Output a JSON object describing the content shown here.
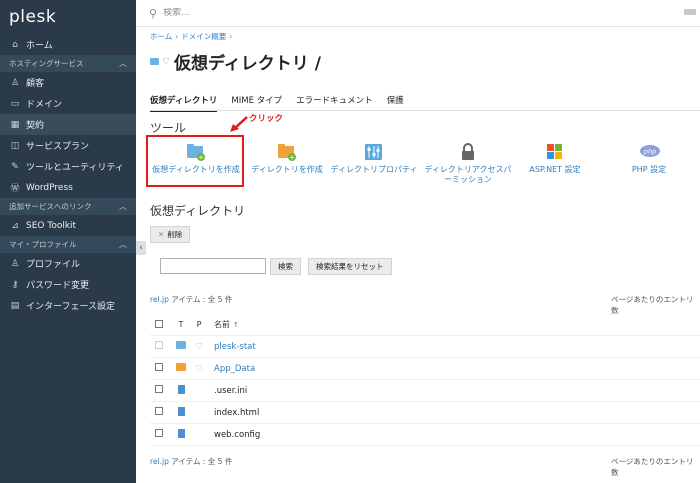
{
  "sidebar": {
    "logo": "plesk",
    "items": [
      {
        "label": "ホーム",
        "icon": "home-icon",
        "glyph": "⌂"
      },
      {
        "section": "ホスティングサービス"
      },
      {
        "label": "顧客",
        "icon": "user-icon",
        "glyph": "♙"
      },
      {
        "label": "ドメイン",
        "icon": "monitor-icon",
        "glyph": "▭"
      },
      {
        "label": "契約",
        "icon": "grid-icon",
        "glyph": "▦",
        "active": true
      },
      {
        "label": "サービスプラン",
        "icon": "book-icon",
        "glyph": "◫"
      },
      {
        "label": "ツールとユーティリティ",
        "icon": "tools-icon",
        "glyph": "✎"
      },
      {
        "label": "WordPress",
        "icon": "wordpress-icon",
        "glyph": "Ⓦ"
      },
      {
        "section": "追加サービスへのリンク"
      },
      {
        "label": "SEO Toolkit",
        "icon": "chart-icon",
        "glyph": "⊿"
      },
      {
        "section": "マイ・プロファイル"
      },
      {
        "label": "プロファイル",
        "icon": "profile-icon",
        "glyph": "♙"
      },
      {
        "label": "パスワード変更",
        "icon": "key-icon",
        "glyph": "⚷"
      },
      {
        "label": "インターフェース設定",
        "icon": "settings-icon",
        "glyph": "▤"
      }
    ]
  },
  "search": {
    "placeholder": "検索..."
  },
  "breadcrumb": {
    "items": [
      "ホーム",
      "ドメイン概要"
    ]
  },
  "page": {
    "title": "仮想ディレクトリ /"
  },
  "tabs": [
    "仮想ディレクトリ",
    "MIME タイプ",
    "エラードキュメント",
    "保護"
  ],
  "tools": {
    "heading": "ツール",
    "click_annotation": "クリック",
    "items": [
      {
        "label": "仮想ディレクトリを作成",
        "icon": "folder-add-icon",
        "color": "#6cb3e3"
      },
      {
        "label": "ディレクトリを作成",
        "icon": "folder-add-orange-icon",
        "color": "#f0a23a"
      },
      {
        "label": "ディレクトリプロパティ",
        "icon": "sliders-icon",
        "color": "#5aa7db"
      },
      {
        "label": "ディレクトリアクセスパーミッション",
        "icon": "lock-icon",
        "color": "#666666"
      },
      {
        "label": "ASP.NET 設定",
        "icon": "windows-icon",
        "color": "#e8532c"
      },
      {
        "label": "PHP 設定",
        "icon": "php-icon",
        "color": "#8f9ee0"
      }
    ]
  },
  "vdirs": {
    "heading": "仮想ディレクトリ",
    "delete_label": "削除",
    "search_label": "検索",
    "reset_label": "検索結果をリセット",
    "domain": "rel.jp",
    "count_text": " アイテム : 全 5 件",
    "per_page_text": "ページあたりのエントリ数",
    "columns": {
      "t": "T",
      "p": "P",
      "name": "名前"
    },
    "rows": [
      {
        "name": "plesk-stat",
        "type": "folder",
        "color": "#6cb3e3",
        "link": true,
        "shield": true,
        "checkbox_dim": true
      },
      {
        "name": "App_Data",
        "type": "folder",
        "color": "#f0a23a",
        "link": true,
        "shield": true,
        "checkbox_dim": false
      },
      {
        "name": ".user.ini",
        "type": "file",
        "link": false,
        "shield": false,
        "checkbox_dim": false
      },
      {
        "name": "index.html",
        "type": "file",
        "link": false,
        "shield": false,
        "checkbox_dim": false
      },
      {
        "name": "web.config",
        "type": "file",
        "link": false,
        "shield": false,
        "checkbox_dim": false
      }
    ]
  }
}
